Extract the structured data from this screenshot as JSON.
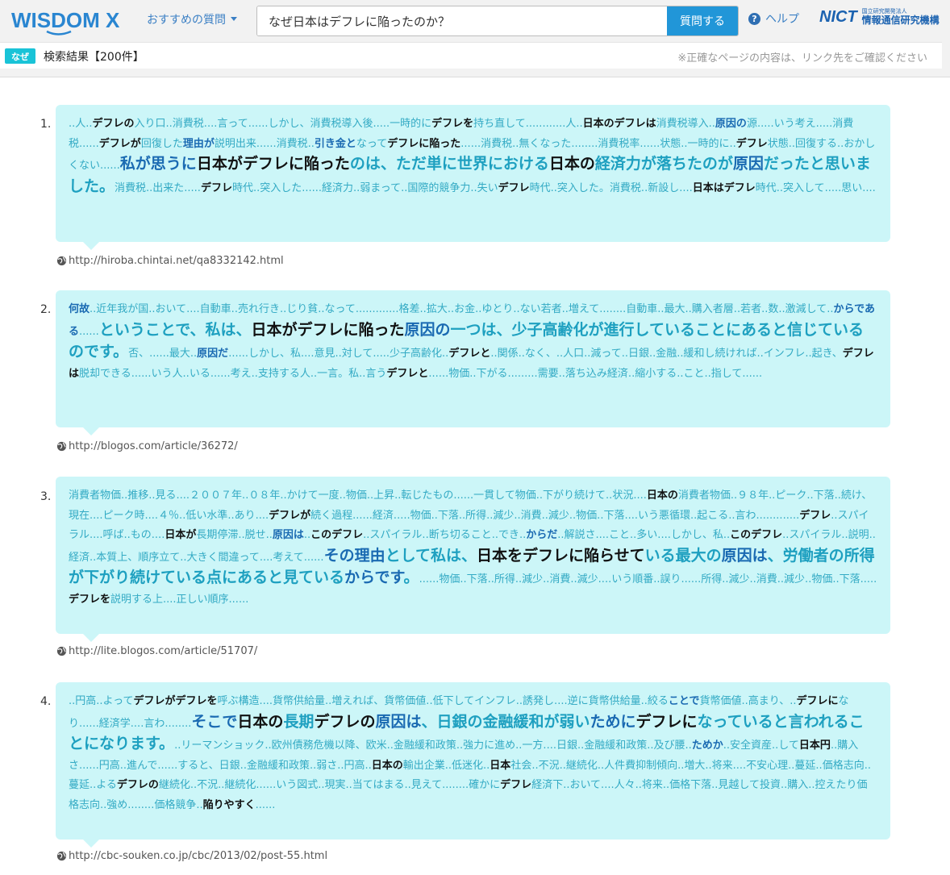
{
  "header": {
    "logo_text": "WISDOM X",
    "suggest_label": "おすすめの質問",
    "search_value": "なぜ日本はデフレに陥ったのか？",
    "search_button": "質問する",
    "help_label": "ヘルプ",
    "help_glyph": "?",
    "nict_mark": "NICT",
    "nict_small": "国立研究開発法人",
    "nict_name": "情報通信研究機構"
  },
  "status": {
    "tag": "なぜ",
    "result_count": "検索結果【200件】",
    "notice": "※正確なページの内容は、リンク先をご確認ください"
  },
  "colors": {
    "accent": "#2196d8",
    "card_bg": "#ccf6f8",
    "tag_bg": "#19c3d7"
  },
  "results": [
    {
      "number": "1.",
      "url": "http://hiroba.chintai.net/qa8332142.html",
      "segments": [
        {
          "t": "..人..",
          "s": "n"
        },
        {
          "t": "デフレの",
          "s": "k"
        },
        {
          "t": "入り口..消費税....言って......しかし、消費税導入後.....一時的に",
          "s": "n"
        },
        {
          "t": "デフレを",
          "s": "k"
        },
        {
          "t": "持ち直して............人..",
          "s": "n"
        },
        {
          "t": "日本のデフレは",
          "s": "k"
        },
        {
          "t": "消費税導入..",
          "s": "n"
        },
        {
          "t": "原因の",
          "s": "kb"
        },
        {
          "t": "源.....いう考え.....消費税......",
          "s": "n"
        },
        {
          "t": "デフレが",
          "s": "k"
        },
        {
          "t": "回復した",
          "s": "n"
        },
        {
          "t": "理由が",
          "s": "kb"
        },
        {
          "t": "説明出来......消費税..",
          "s": "n"
        },
        {
          "t": "引き金と",
          "s": "kb"
        },
        {
          "t": "なって",
          "s": "n"
        },
        {
          "t": "デフレに陥った",
          "s": "k"
        },
        {
          "t": "......消費税..無くなった........消費税率......状態..一時的に..",
          "s": "n"
        },
        {
          "t": "デフレ",
          "s": "k"
        },
        {
          "t": "状態..回復する..おかしくない......",
          "s": "n"
        },
        {
          "t": "私が思うに",
          "s": "bb"
        },
        {
          "t": "日本がデフレに陥った",
          "s": "bk"
        },
        {
          "t": "のは、ただ単に世界における",
          "s": "b"
        },
        {
          "t": "日本の",
          "s": "bk"
        },
        {
          "t": "経済力が落ちたのが",
          "s": "b"
        },
        {
          "t": "原因",
          "s": "bb"
        },
        {
          "t": "だったと思いました。",
          "s": "b"
        },
        {
          "t": "消費税..出来た.....",
          "s": "n"
        },
        {
          "t": "デフレ",
          "s": "k"
        },
        {
          "t": "時代..突入した......経済力..弱まって..国際的競争力..失い",
          "s": "n"
        },
        {
          "t": "デフレ",
          "s": "k"
        },
        {
          "t": "時代..突入した。消費税..新設し....",
          "s": "n"
        },
        {
          "t": "日本はデフレ",
          "s": "k"
        },
        {
          "t": "時代..突入して.....思い....",
          "s": "n"
        }
      ]
    },
    {
      "number": "2.",
      "url": "http://blogos.com/article/36272/",
      "segments": [
        {
          "t": "何故",
          "s": "kb"
        },
        {
          "t": "..近年我が国..おいて....自動車..売れ行き..じり貧..なって.............格差..拡大..お金..ゆとり..ない若者..増えて........自動車..最大..購入者層..若者..数..激減して..",
          "s": "n"
        },
        {
          "t": "からである",
          "s": "kb"
        },
        {
          "t": "......",
          "s": "n"
        },
        {
          "t": "ということで、私は、",
          "s": "b"
        },
        {
          "t": "日本がデフレに陥った",
          "s": "bk"
        },
        {
          "t": "原因の",
          "s": "bb"
        },
        {
          "t": "一つは、少子高齢化が進行していることにあると信じているのです。",
          "s": "b"
        },
        {
          "t": "否、......最大..",
          "s": "n"
        },
        {
          "t": "原因だ",
          "s": "kb"
        },
        {
          "t": "......しかし、私....意見..対して.....少子高齢化..",
          "s": "n"
        },
        {
          "t": "デフレと",
          "s": "k"
        },
        {
          "t": "..関係..なく、..人口..減って..日銀..金融..緩和し続ければ..インフレ..起き、",
          "s": "n"
        },
        {
          "t": "デフレは",
          "s": "k"
        },
        {
          "t": "脱却できる......いう人..いる......考え..支持する人..一言。私..言う",
          "s": "n"
        },
        {
          "t": "デフレと",
          "s": "k"
        },
        {
          "t": "......物価..下がる.........需要..落ち込み経済..縮小する..こと..指して......",
          "s": "n"
        }
      ]
    },
    {
      "number": "3.",
      "url": "http://lite.blogos.com/article/51707/",
      "segments": [
        {
          "t": "消費者物価..推移..見る....２００７年..０８年..かけて一度..物価..上昇..転じたもの......一貫して物価..下がり続けて..状況....",
          "s": "n"
        },
        {
          "t": "日本の",
          "s": "k"
        },
        {
          "t": "消費者物価..９８年..ピーク..下落..続け、現在....ピーク時....４％..低い水準..あり....",
          "s": "n"
        },
        {
          "t": "デフレが",
          "s": "k"
        },
        {
          "t": "続く過程......経済.....物価..下落..所得..減少..消費..減少..物価..下落....いう悪循環..起こる..言わ.............",
          "s": "n"
        },
        {
          "t": "デフレ",
          "s": "k"
        },
        {
          "t": "..スパイラル....呼ば..もの....",
          "s": "n"
        },
        {
          "t": "日本が",
          "s": "k"
        },
        {
          "t": "長期停滞..脱せ..",
          "s": "n"
        },
        {
          "t": "原因は",
          "s": "kb"
        },
        {
          "t": "..",
          "s": "n"
        },
        {
          "t": "このデフレ",
          "s": "k"
        },
        {
          "t": "..スパイラル..断ち切ること..でき..",
          "s": "n"
        },
        {
          "t": "からだ",
          "s": "kb"
        },
        {
          "t": "..解説さ....こと..多い....しかし、私..",
          "s": "n"
        },
        {
          "t": "このデフレ",
          "s": "k"
        },
        {
          "t": "..スパイラル..説明..経済..本質上、順序立て..大きく間違って....考えて......",
          "s": "n"
        },
        {
          "t": "その理由",
          "s": "bb"
        },
        {
          "t": "として私は、",
          "s": "b"
        },
        {
          "t": "日本をデフレに陥らせて",
          "s": "bk"
        },
        {
          "t": "いる最大の",
          "s": "b"
        },
        {
          "t": "原因は",
          "s": "bb"
        },
        {
          "t": "、労働者の所得が下がり続けている点にあると見ている",
          "s": "b"
        },
        {
          "t": "からです",
          "s": "bb"
        },
        {
          "t": "。",
          "s": "b"
        },
        {
          "t": "......物価..下落..所得..減少..消費..減少....いう順番..誤り......所得..減少..消費..減少..物価..下落.....",
          "s": "n"
        },
        {
          "t": "デフレを",
          "s": "k"
        },
        {
          "t": "説明する上....正しい順序......",
          "s": "n"
        }
      ]
    },
    {
      "number": "4.",
      "url": "http://cbc-souken.co.jp/cbc/2013/02/post-55.html",
      "segments": [
        {
          "t": "..円高..よって",
          "s": "n"
        },
        {
          "t": "デフレがデフレを",
          "s": "k"
        },
        {
          "t": "呼ぶ構造....貨幣供給量..増えれば、貨幣価値..低下してインフレ..誘発し....逆に貨幣供給量..絞る",
          "s": "n"
        },
        {
          "t": "ことで",
          "s": "kb"
        },
        {
          "t": "貨幣価値..高まり、..",
          "s": "n"
        },
        {
          "t": "デフレに",
          "s": "k"
        },
        {
          "t": "なり......経済学....言わ........",
          "s": "n"
        },
        {
          "t": "そこで",
          "s": "bb"
        },
        {
          "t": "日本の",
          "s": "bk"
        },
        {
          "t": "長期",
          "s": "b"
        },
        {
          "t": "デフレの",
          "s": "bk"
        },
        {
          "t": "原因は",
          "s": "bb"
        },
        {
          "t": "、日銀の金融緩和が弱い",
          "s": "b"
        },
        {
          "t": "ために",
          "s": "bb"
        },
        {
          "t": "デフレに",
          "s": "bk"
        },
        {
          "t": "なっていると言われることになります。",
          "s": "b"
        },
        {
          "t": "..リーマンショック..欧州債務危機以降、欧米..金融緩和政策..強力に進め..一方....日銀..金融緩和政策..及び腰..",
          "s": "n"
        },
        {
          "t": "ためか",
          "s": "kb"
        },
        {
          "t": "..安全資産..して",
          "s": "n"
        },
        {
          "t": "日本円",
          "s": "k"
        },
        {
          "t": "..購入さ......円高..進んで......すると、日銀..金融緩和政策..弱さ..円高..",
          "s": "n"
        },
        {
          "t": "日本の",
          "s": "k"
        },
        {
          "t": "輸出企業..低迷化..",
          "s": "n"
        },
        {
          "t": "日本",
          "s": "k"
        },
        {
          "t": "社会..不況..継続化..人件費抑制傾向..増大..将来....不安心理..蔓延..価格志向..蔓延..よる",
          "s": "n"
        },
        {
          "t": "デフレの",
          "s": "k"
        },
        {
          "t": "継続化..不況..継続化......いう図式..現実..当てはまる..見えて........確かに",
          "s": "n"
        },
        {
          "t": "デフレ",
          "s": "k"
        },
        {
          "t": "経済下..おいて....人々..将来..価格下落..見越して投資..購入..控えたり価格志向..強め........価格競争..",
          "s": "n"
        },
        {
          "t": "陥りやすく",
          "s": "k"
        },
        {
          "t": "......",
          "s": "n"
        }
      ]
    }
  ]
}
